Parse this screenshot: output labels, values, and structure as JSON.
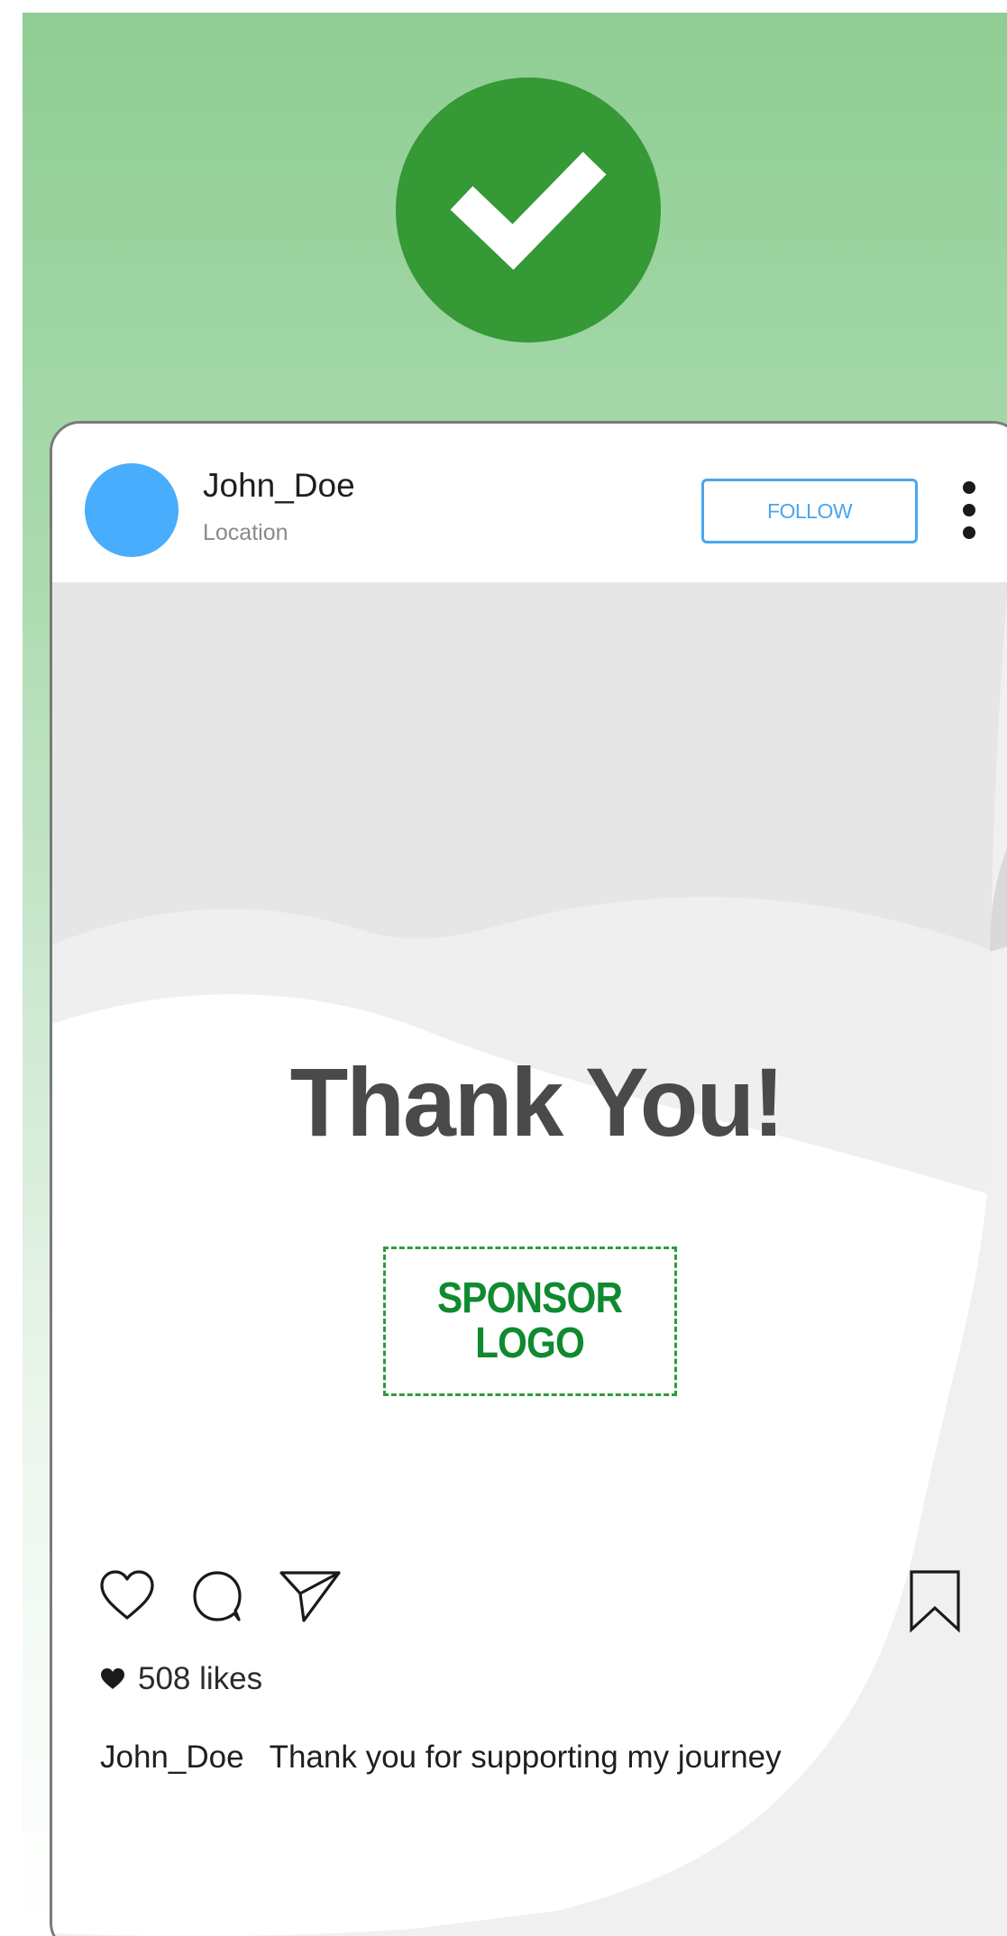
{
  "colors": {
    "badge_green": "#359935",
    "avatar_blue": "#48adfc",
    "follow_blue": "#4aa6ee",
    "sponsor_green": "#0f8a2f"
  },
  "success_badge": {
    "icon": "checkmark-icon"
  },
  "post": {
    "username": "John_Doe",
    "location": "Location",
    "follow_label": "FOLLOW",
    "more_icon": "more-vertical-icon",
    "image": {
      "headline": "Thank You!",
      "sponsor_label": "SPONSOR\nLOGO"
    },
    "actions": {
      "like_icon": "heart-outline-icon",
      "comment_icon": "comment-icon",
      "share_icon": "send-icon",
      "save_icon": "bookmark-icon"
    },
    "likes_text": "508 likes",
    "caption": {
      "user": "John_Doe",
      "text": "Thank you for supporting my journey"
    }
  }
}
